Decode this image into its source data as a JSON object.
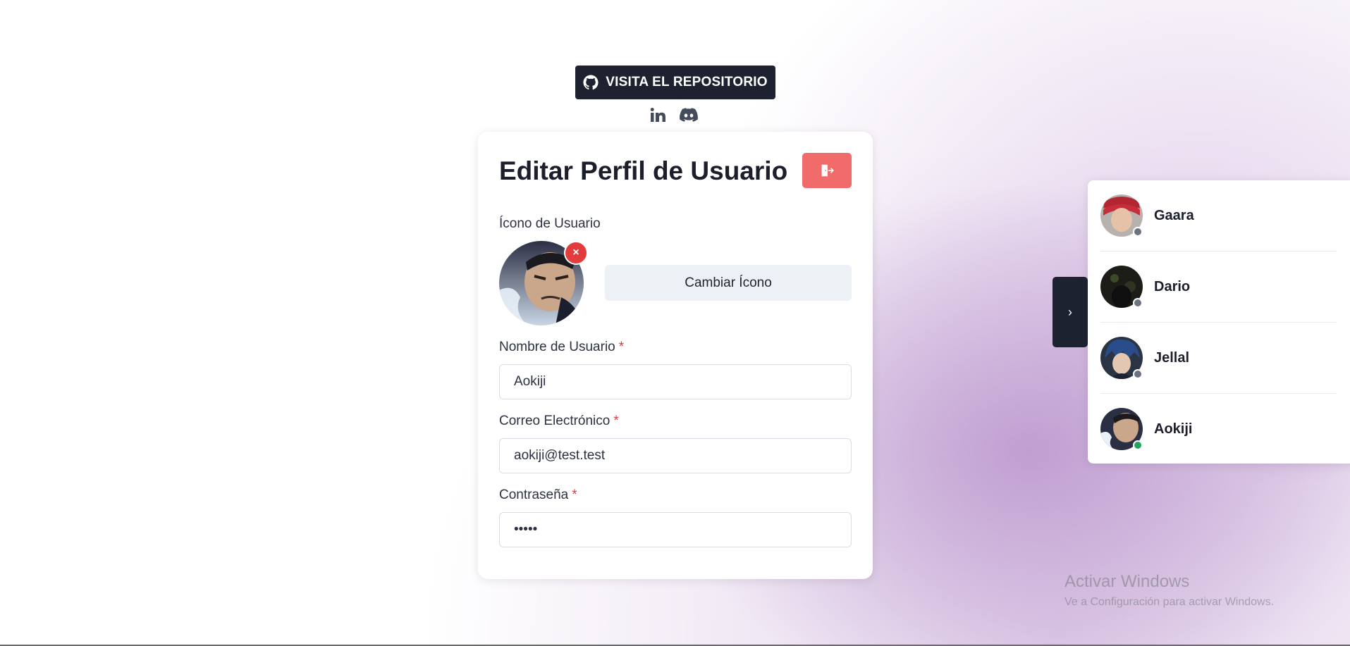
{
  "header": {
    "repo_button_label": "VISITA EL REPOSITORIO",
    "social_icons": [
      "linkedin-icon",
      "discord-icon"
    ]
  },
  "profile_card": {
    "title": "Editar Perfil de Usuario",
    "logout_icon": "logout-icon",
    "icon_section_label": "Ícono de Usuario",
    "remove_icon_glyph": "×",
    "change_icon_label": "Cambiar Ícono",
    "username": {
      "label": "Nombre de Usuario",
      "required": "*",
      "value": "Aokiji"
    },
    "email": {
      "label": "Correo Electrónico",
      "required": "*",
      "value": "aokiji@test.test"
    },
    "password": {
      "label": "Contraseña",
      "required": "*",
      "value": "aokij"
    }
  },
  "toggle": {
    "glyph": "›"
  },
  "users_panel": {
    "users": [
      {
        "name": "Gaara",
        "status": "offline",
        "status_color": "#6b7280"
      },
      {
        "name": "Dario",
        "status": "offline",
        "status_color": "#6b7280"
      },
      {
        "name": "Jellal",
        "status": "offline",
        "status_color": "#6b7280"
      },
      {
        "name": "Aokiji",
        "status": "online",
        "status_color": "#22a55a"
      }
    ]
  },
  "watermark": {
    "title": "Activar Windows",
    "subtitle": "Ve a Configuración para activar Windows."
  },
  "colors": {
    "dark": "#1e2230",
    "danger": "#f26b6b",
    "required": "#e0383e"
  }
}
